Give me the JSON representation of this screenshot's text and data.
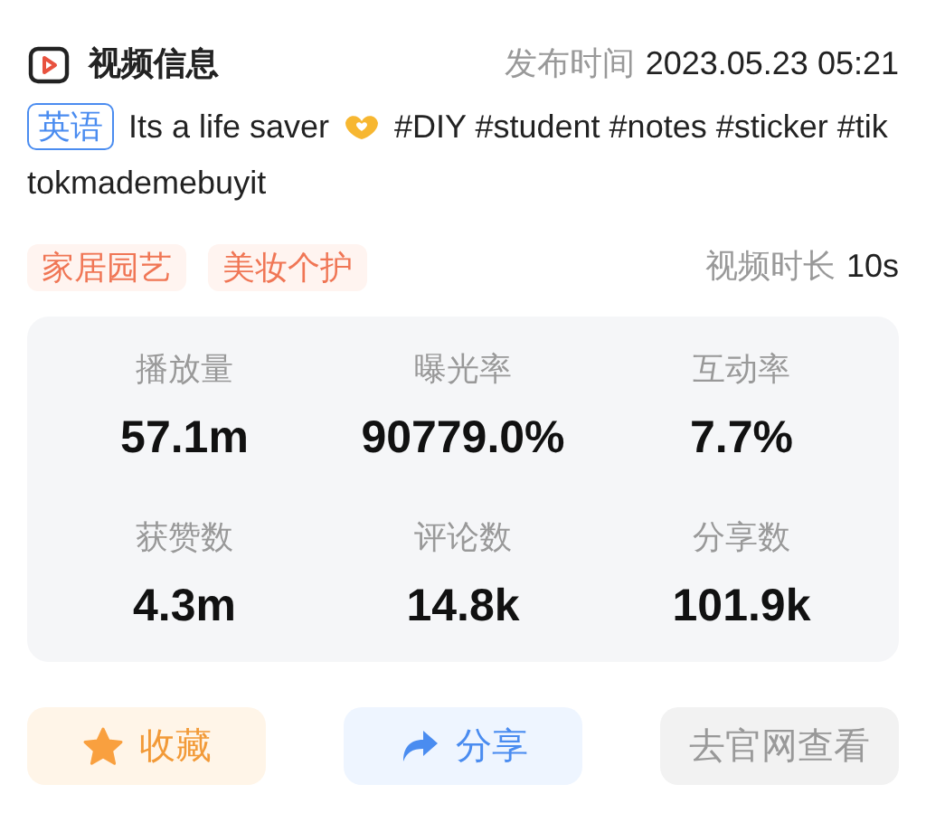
{
  "header": {
    "title": "视频信息",
    "publish_label": "发布时间",
    "publish_time": "2023.05.23 05:21"
  },
  "description": {
    "language_tag": "英语",
    "text_before": "Its a life saver",
    "text_after": "#DIY #student #notes #sticker #tiktokmademebuyit"
  },
  "categories": [
    "家居园艺",
    "美妆个护"
  ],
  "duration": {
    "label": "视频时长",
    "value": "10s"
  },
  "stats": [
    {
      "label": "播放量",
      "value": "57.1m"
    },
    {
      "label": "曝光率",
      "value": "90779.0%"
    },
    {
      "label": "互动率",
      "value": "7.7%"
    },
    {
      "label": "获赞数",
      "value": "4.3m"
    },
    {
      "label": "评论数",
      "value": "14.8k"
    },
    {
      "label": "分享数",
      "value": "101.9k"
    }
  ],
  "buttons": [
    {
      "kind": "favorite",
      "label": "收藏"
    },
    {
      "kind": "share",
      "label": "分享"
    },
    {
      "kind": "official",
      "label": "去官网查看"
    }
  ]
}
